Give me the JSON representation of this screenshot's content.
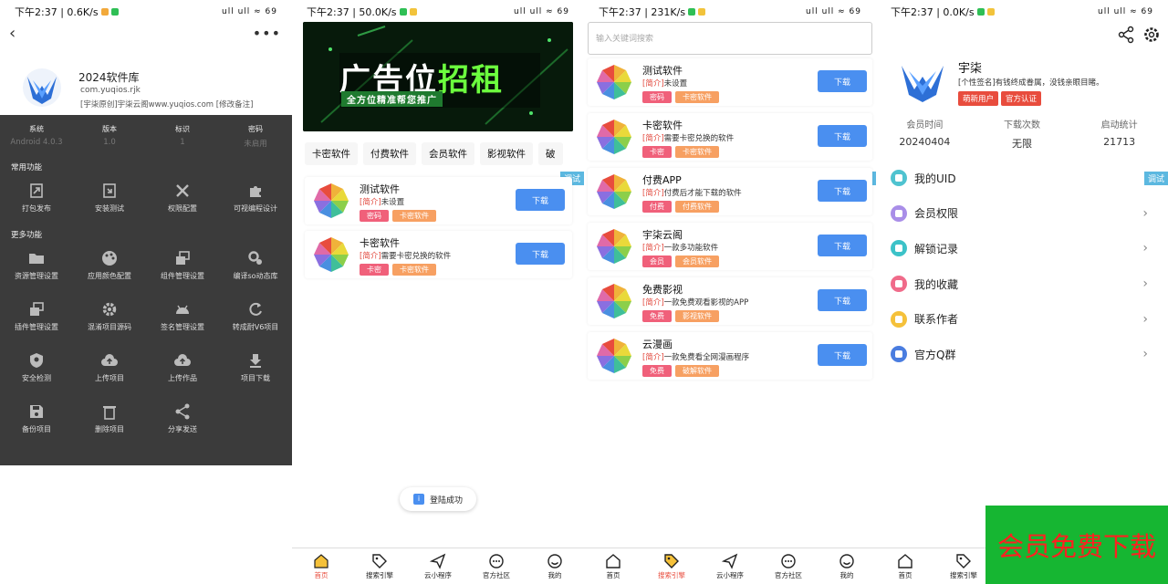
{
  "colors": {
    "accent_red": "#e84c3d",
    "button_blue": "#4a8ff0",
    "tag_red": "#f0607a",
    "tag_orange": "#f7a062",
    "dark_panel": "#3b3b3b",
    "promo_green": "#16b632"
  },
  "panel1": {
    "status": {
      "time": "下午2:37 | 0.6K/s",
      "right": "ull ull ≈ 69"
    },
    "app_name": "2024软件库",
    "package": "com.yuqios.rjk",
    "note": "[宇柒原创]宇柒云阁www.yuqios.com [修改备注]",
    "info": [
      {
        "k": "系统",
        "v": "Android 4.0.3"
      },
      {
        "k": "版本",
        "v": "1.0"
      },
      {
        "k": "标识",
        "v": "1"
      },
      {
        "k": "密码",
        "v": "未启用"
      }
    ],
    "common_title": "常用功能",
    "common": [
      {
        "label": "打包发布",
        "icon": "package-icon"
      },
      {
        "label": "安装测试",
        "icon": "install-icon"
      },
      {
        "label": "权限配置",
        "icon": "tools-icon"
      },
      {
        "label": "可视编程设计",
        "icon": "puzzle-icon"
      }
    ],
    "more_title": "更多功能",
    "more": [
      {
        "label": "资源管理设置",
        "icon": "folder-icon"
      },
      {
        "label": "应用颜色配置",
        "icon": "palette-icon"
      },
      {
        "label": "组件管理设置",
        "icon": "layers-icon"
      },
      {
        "label": "编译so动态库",
        "icon": "gears-icon"
      },
      {
        "label": "插件管理设置",
        "icon": "plugin-icon"
      },
      {
        "label": "混淆项目源码",
        "icon": "settings-icon"
      },
      {
        "label": "签名管理设置",
        "icon": "android-icon"
      },
      {
        "label": "转成耐V6项目",
        "icon": "refresh-icon"
      },
      {
        "label": "安全检测",
        "icon": "shield-icon"
      },
      {
        "label": "上传项目",
        "icon": "cloud-upload-icon"
      },
      {
        "label": "上传作品",
        "icon": "cloud-upload-icon"
      },
      {
        "label": "项目下载",
        "icon": "download-icon"
      },
      {
        "label": "备份项目",
        "icon": "save-icon"
      },
      {
        "label": "删除项目",
        "icon": "trash-icon"
      },
      {
        "label": "分享发送",
        "icon": "share-icon"
      }
    ]
  },
  "panel2": {
    "status": {
      "time": "下午2:37 | 50.0K/s",
      "right": "ull ull ≈ 69"
    },
    "banner": {
      "title_white": "广告位",
      "title_green": "招租",
      "subtitle": "全方位精准帮您推广"
    },
    "tabs": [
      "卡密软件",
      "付费软件",
      "会员软件",
      "影视软件",
      "破"
    ],
    "debug": "调试",
    "items": [
      {
        "title": "测试软件",
        "pre": "[简介]",
        "desc": "未设置",
        "tag1": "密码",
        "tag2": "卡密软件",
        "btn": "下载"
      },
      {
        "title": "卡密软件",
        "pre": "[简介]",
        "desc": "需要卡密兑换的软件",
        "tag1": "卡密",
        "tag2": "卡密软件",
        "btn": "下载"
      }
    ],
    "toast": "登陆成功",
    "toast_icon": "i"
  },
  "panel3": {
    "status": {
      "time": "下午2:37 | 231K/s",
      "right": "ull ull ≈ 69"
    },
    "search_placeholder": "输入关键词搜索",
    "debug": "调试",
    "items": [
      {
        "title": "测试软件",
        "pre": "[简介]",
        "desc": "未设置",
        "tag1": "密码",
        "tag2": "卡密软件",
        "btn": "下载"
      },
      {
        "title": "卡密软件",
        "pre": "[简介]",
        "desc": "需要卡密兑换的软件",
        "tag1": "卡密",
        "tag2": "卡密软件",
        "btn": "下载"
      },
      {
        "title": "付费APP",
        "pre": "[简介]",
        "desc": "付费后才能下载的软件",
        "tag1": "付费",
        "tag2": "付费软件",
        "btn": "下载"
      },
      {
        "title": "宇柒云阁",
        "pre": "[简介]",
        "desc": "一款多功能软件",
        "tag1": "会员",
        "tag2": "会员软件",
        "btn": "下载"
      },
      {
        "title": "免费影视",
        "pre": "[简介]",
        "desc": "一款免费观看影视的APP",
        "tag1": "免费",
        "tag2": "影视软件",
        "btn": "下载"
      },
      {
        "title": "云漫画",
        "pre": "[简介]",
        "desc": "一款免费看全网漫画程序",
        "tag1": "免费",
        "tag2": "破解软件",
        "btn": "下载"
      }
    ]
  },
  "panel4": {
    "status": {
      "time": "下午2:37 | 0.0K/s",
      "right": "ull ull ≈ 69"
    },
    "username": "宇柒",
    "signature": "[个性签名]有钱终成眷属，没钱亲眼目睹。",
    "badges": [
      "萌新用户",
      "官方认证"
    ],
    "stats": [
      {
        "k": "会员时间",
        "v": "20240404"
      },
      {
        "k": "下载次数",
        "v": "无限"
      },
      {
        "k": "启动统计",
        "v": "21713"
      }
    ],
    "debug": "调试",
    "menu": [
      {
        "label": "我的UID",
        "color": "#4fc3d0",
        "icon": "uid-icon"
      },
      {
        "label": "会员权限",
        "color": "#a98ee8",
        "icon": "vip-icon"
      },
      {
        "label": "解锁记录",
        "color": "#3cc2c8",
        "icon": "unlock-icon"
      },
      {
        "label": "我的收藏",
        "color": "#f06b8a",
        "icon": "favorite-icon"
      },
      {
        "label": "联系作者",
        "color": "#f5c13a",
        "icon": "contact-icon"
      },
      {
        "label": "官方Q群",
        "color": "#4a7de0",
        "icon": "group-icon"
      }
    ]
  },
  "nav": [
    "首页",
    "搜索引擎",
    "云小程序",
    "官方社区",
    "我的"
  ],
  "nav_short": [
    "首页",
    "搜索引擎"
  ],
  "promo": "会员免费下载"
}
